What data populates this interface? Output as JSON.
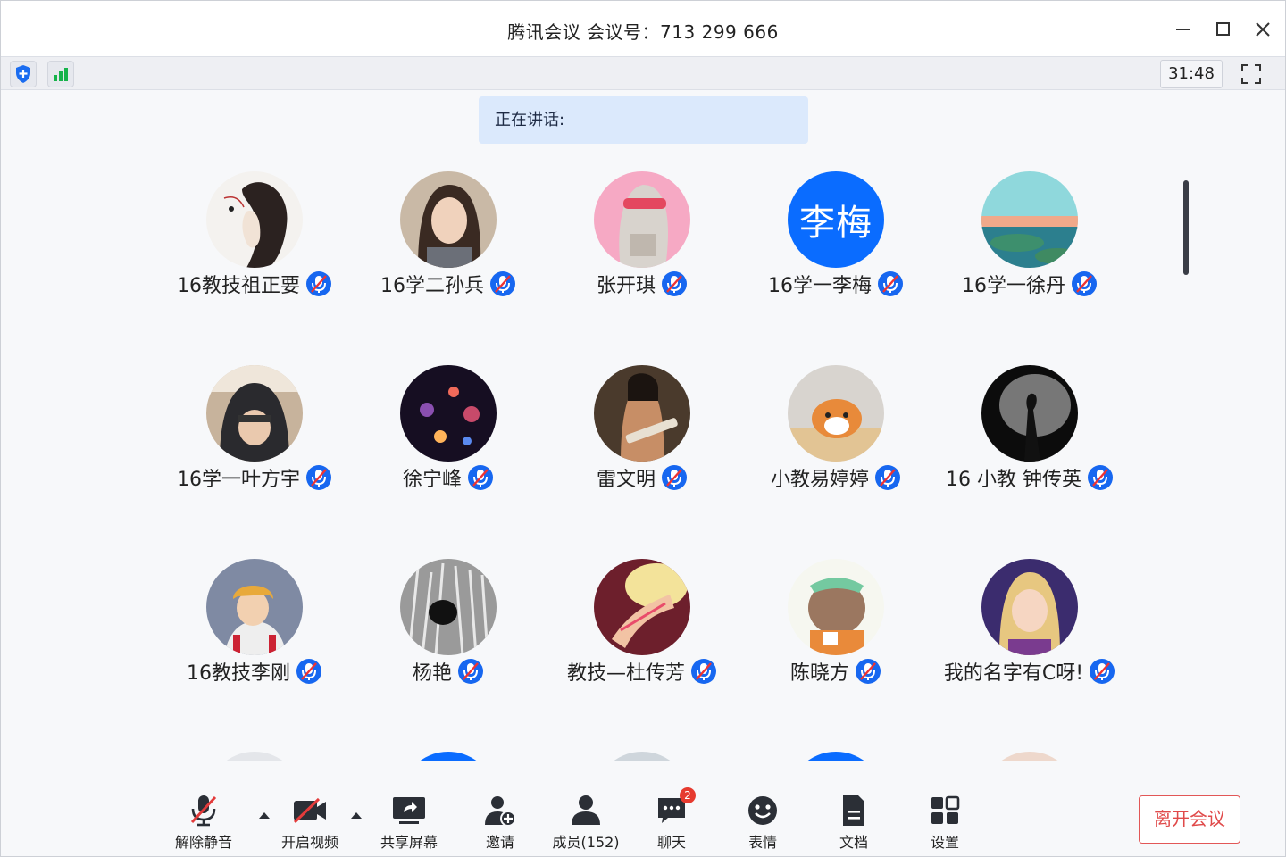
{
  "window": {
    "title": "腾讯会议 会议号：713 299 666",
    "controls": [
      "minimize-icon",
      "maximize-icon",
      "close-icon"
    ]
  },
  "infobar": {
    "icons": [
      "shield-icon",
      "signal-icon"
    ],
    "timer": "31:48",
    "fullscreen_icon": "fullscreen-icon"
  },
  "speaking": {
    "label": "正在讲话:"
  },
  "colors": {
    "accent": "#0a6cff",
    "leave": "#e04a4a",
    "badge": "#e63a2f",
    "banner": "#dbe9fc"
  },
  "participants": [
    {
      "name": "16教技祖正要",
      "muted": true
    },
    {
      "name": "16学二孙兵",
      "muted": true
    },
    {
      "name": "张开琪",
      "muted": true
    },
    {
      "name": "16学一李梅",
      "muted": true,
      "avatar_text": "李梅"
    },
    {
      "name": "16学一徐丹",
      "muted": true
    },
    {
      "name": "16学一叶方宇",
      "muted": true
    },
    {
      "name": "徐宁峰",
      "muted": true
    },
    {
      "name": "雷文明",
      "muted": true
    },
    {
      "name": "小教易婷婷",
      "muted": true
    },
    {
      "name": "16 小教 钟传英",
      "muted": true
    },
    {
      "name": "16教技李刚",
      "muted": true
    },
    {
      "name": "杨艳",
      "muted": true
    },
    {
      "name": "教技—杜传芳",
      "muted": true
    },
    {
      "name": "陈晓方",
      "muted": true
    },
    {
      "name": "我的名字有C呀!",
      "muted": true
    }
  ],
  "toolbar": {
    "unmute": "解除静音",
    "video": "开启视频",
    "share": "共享屏幕",
    "invite": "邀请",
    "members": "成员(152)",
    "chat": "聊天",
    "chat_badge": "2",
    "reactions": "表情",
    "docs": "文档",
    "settings": "设置",
    "leave": "离开会议"
  }
}
